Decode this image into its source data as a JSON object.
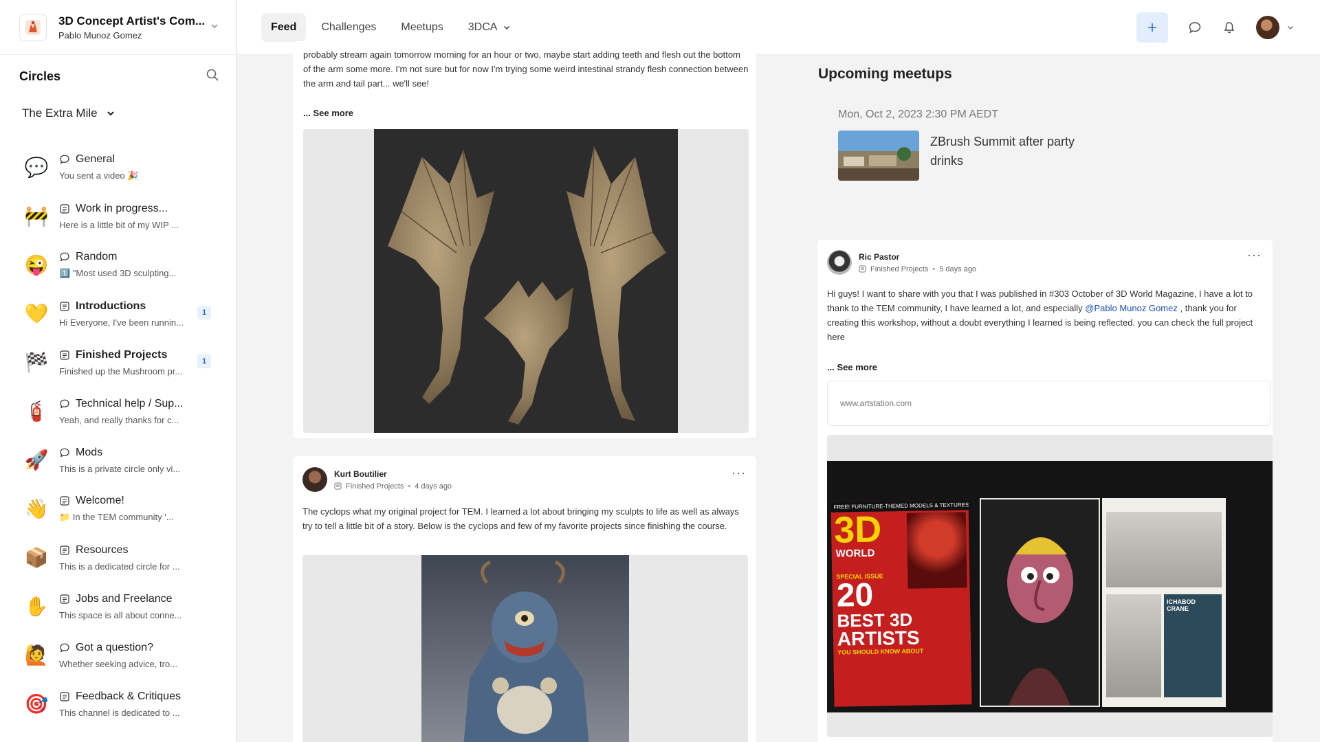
{
  "community": {
    "name": "3D Concept Artist's Com...",
    "user": "Pablo Munoz Gomez"
  },
  "sidebar": {
    "title": "Circles",
    "space": "The Extra Mile",
    "items": [
      {
        "name": "General",
        "preview": "You sent a video 🎉",
        "type": "chat",
        "emoji": "💬",
        "bold": false,
        "badge": ""
      },
      {
        "name": "Work in progress...",
        "preview": "Here is a little bit of my WIP ...",
        "type": "posts",
        "emoji": "🚧",
        "bold": false,
        "badge": ""
      },
      {
        "name": "Random",
        "preview": "1️⃣ \"Most used 3D sculpting...",
        "type": "chat",
        "emoji": "😜",
        "bold": false,
        "badge": ""
      },
      {
        "name": "Introductions",
        "preview": "Hi Everyone, I've been runnin...",
        "type": "posts",
        "emoji": "💛",
        "bold": true,
        "badge": "1"
      },
      {
        "name": "Finished Projects",
        "preview": "Finished up the Mushroom pr...",
        "type": "posts",
        "emoji": "🏁",
        "bold": true,
        "badge": "1"
      },
      {
        "name": "Technical help / Sup...",
        "preview": "Yeah, and really thanks for c...",
        "type": "chat",
        "emoji": "🧯",
        "bold": false,
        "badge": ""
      },
      {
        "name": "Mods",
        "preview": "This is a private circle only vi...",
        "type": "chat",
        "emoji": "🚀",
        "bold": false,
        "badge": ""
      },
      {
        "name": "Welcome!",
        "preview": "📁 In the TEM community '...",
        "type": "posts",
        "emoji": "👋",
        "bold": false,
        "badge": ""
      },
      {
        "name": "Resources",
        "preview": "This is a dedicated circle for ...",
        "type": "posts",
        "emoji": "📦",
        "bold": false,
        "badge": ""
      },
      {
        "name": "Jobs and Freelance",
        "preview": "This space is all about conne...",
        "type": "posts",
        "emoji": "✋",
        "bold": false,
        "badge": ""
      },
      {
        "name": "Got a question?",
        "preview": "Whether seeking advice, tro...",
        "type": "chat",
        "emoji": "🙋",
        "bold": false,
        "badge": ""
      },
      {
        "name": "Feedback & Critiques",
        "preview": "This channel is dedicated to ...",
        "type": "posts",
        "emoji": "🎯",
        "bold": false,
        "badge": ""
      }
    ]
  },
  "nav": {
    "tabs": [
      "Feed",
      "Challenges",
      "Meetups",
      "3DCA"
    ],
    "active_tab": "Feed"
  },
  "feed": {
    "post1": {
      "text": "probably stream again tomorrow morning for an hour or two, maybe start adding teeth and flesh out the bottom of the arm some more. I'm not sure but for now I'm trying some weird intestinal strandy flesh connection between the arm and tail part... we'll see!",
      "see_more": "... See more"
    },
    "post2": {
      "author": "Kurt Boutilier",
      "circle": "Finished Projects",
      "time": "4 days ago",
      "text": "The cyclops what my original project for TEM. I learned a lot about bringing my sculpts to life as well as always try to tell a little bit of a story. Below is the cyclops and few of my favorite projects since finishing the course."
    }
  },
  "meetups": {
    "title": "Upcoming meetups",
    "date": "Mon, Oct 2, 2023 2:30 PM AEDT",
    "event": "ZBrush Summit after party drinks"
  },
  "post3": {
    "author": "Ric Pastor",
    "circle": "Finished Projects",
    "time": "5 days ago",
    "text_before": "Hi guys! I want to share with you that I was published in #303 October of 3D World Magazine, I have a lot to thank to the TEM community, I have learned a lot, and especially ",
    "mention": "@Pablo Munoz Gomez",
    "text_after": " , thank you for creating this workshop, without a doubt everything I learned is being reflected. you can check the full project here",
    "see_more": "... See more",
    "link": "www.artstation.com"
  },
  "magazine": {
    "banner": "FREE! FURNITURE-THEMED MODELS & TEXTURES",
    "logo_top": "3D",
    "logo_bottom": "WORLD",
    "special": "SPECIAL ISSUE",
    "headline_1": "20",
    "headline_2": "BEST 3D",
    "headline_3": "ARTISTS",
    "headline_4": "YOU SHOULD KNOW ABOUT",
    "page_title": "ICHABOD CRANE"
  }
}
